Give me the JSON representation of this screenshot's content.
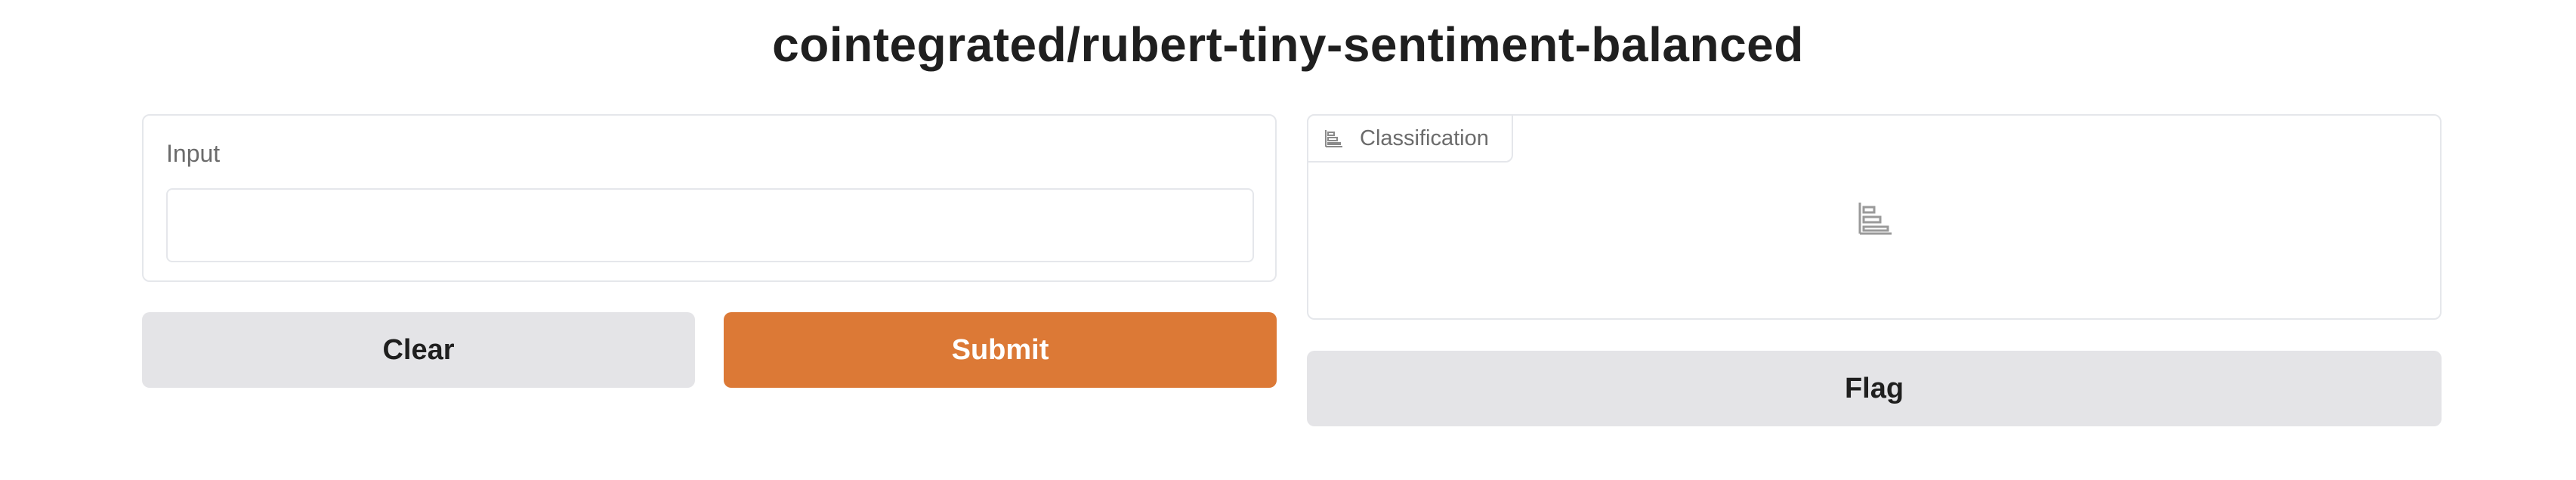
{
  "page": {
    "title": "cointegrated/rubert-tiny-sentiment-balanced"
  },
  "input_panel": {
    "label": "Input",
    "value": "",
    "placeholder": ""
  },
  "buttons": {
    "clear": "Clear",
    "submit": "Submit",
    "flag": "Flag"
  },
  "output_panel": {
    "tab_label": "Classification",
    "icon": "bar-chart-icon"
  },
  "colors": {
    "primary": "#dc7936",
    "secondary_button": "#e4e4e7",
    "border": "#e5e7eb"
  }
}
